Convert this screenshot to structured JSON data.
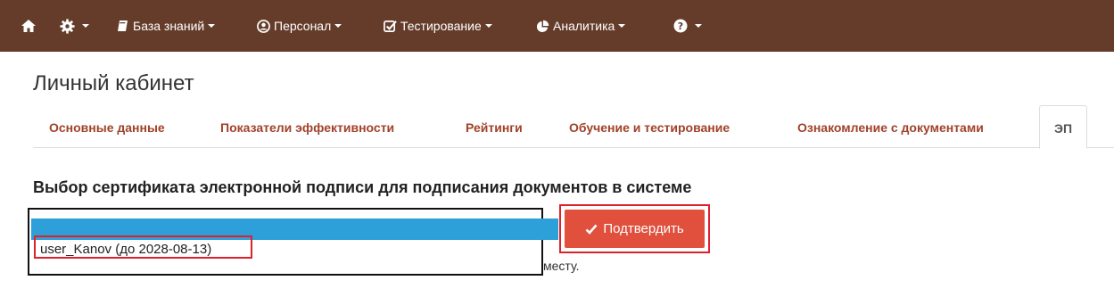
{
  "navbar": {
    "bg_color": "#653c2a",
    "items": [
      {
        "icon": "home-icon",
        "label": ""
      },
      {
        "icon": "gear-icon",
        "label": ""
      },
      {
        "icon": "book-icon",
        "label": "База знаний"
      },
      {
        "icon": "user-circle-icon",
        "label": "Персонал"
      },
      {
        "icon": "checkbox-icon",
        "label": "Тестирование"
      },
      {
        "icon": "pie-chart-icon",
        "label": "Аналитика"
      },
      {
        "icon": "question-icon",
        "label": ""
      }
    ]
  },
  "page": {
    "title": "Личный кабинет"
  },
  "tabs": [
    {
      "label": "Основные данные"
    },
    {
      "label": "Показатели эффективности"
    },
    {
      "label": "Рейтинги"
    },
    {
      "label": "Обучение и тестирование"
    },
    {
      "label": "Ознакомление с документами"
    },
    {
      "label": "ЭП",
      "active": true
    }
  ],
  "signature": {
    "heading": "Выбор сертификата электронной подписи для подписания документов в системе",
    "option": "user_Kanov (до 2028-08-13)",
    "confirm_label": "Подтвердить",
    "hint_fragment": "месту."
  },
  "colors": {
    "accent_red": "#e0503d",
    "highlight_blue": "#2d9fd9",
    "tab_text": "#a0422a"
  }
}
